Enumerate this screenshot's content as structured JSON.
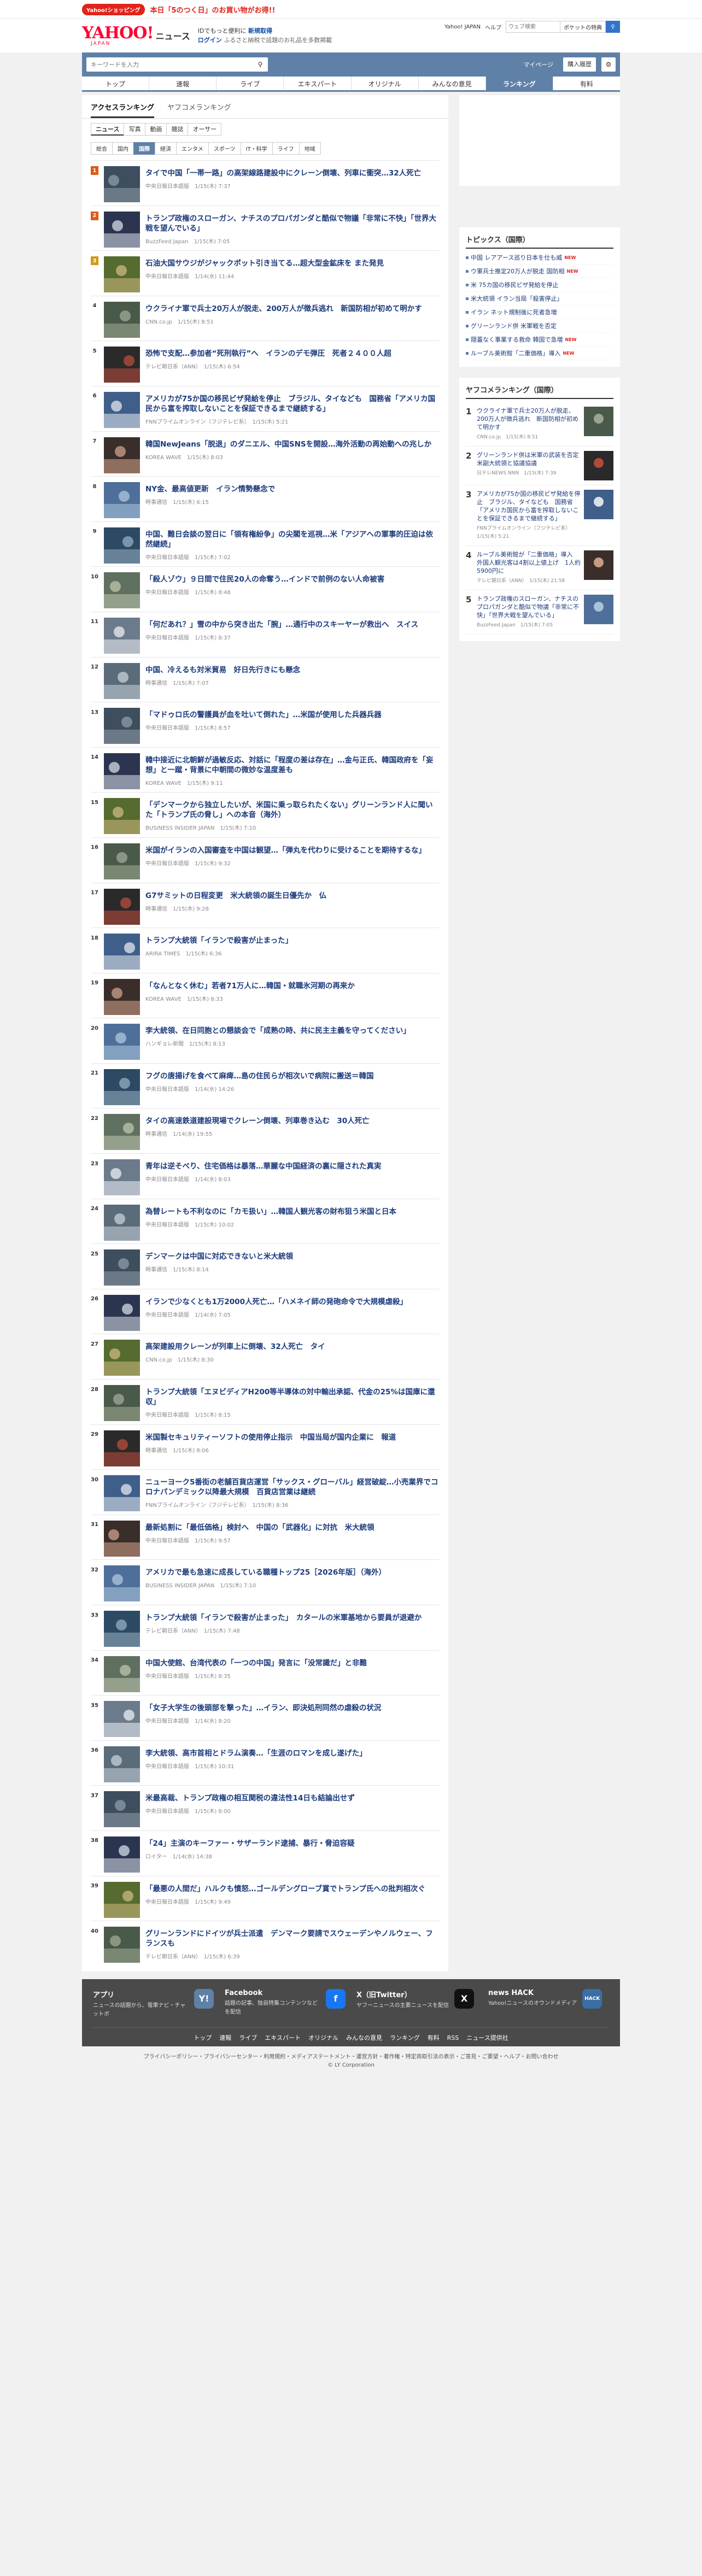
{
  "promo": {
    "pill": "Yahoo!ショッピング",
    "message": "本日「5のつく日」のお買い物がお得!!"
  },
  "header": {
    "logo": "YAHOO!",
    "logo_sub": "JAPAN",
    "section": "ニュース",
    "login_line1": "IDでもっと便利に",
    "login_line1_link": "新規取得",
    "login_line2_link": "ログイン",
    "login_line2_tail": "ふるさと納税で話題のお礼品を多数掲載",
    "links": [
      "Yahoo! JAPAN",
      "ヘルプ"
    ],
    "search_placeholder": "ウェブ検索",
    "search_button": "ポケットの特典"
  },
  "topbar": {
    "placeholder": "キーワードを入力",
    "mypage": "マイページ",
    "purchase": "購入履歴"
  },
  "nav": [
    "トップ",
    "速報",
    "ライブ",
    "エキスパート",
    "オリジナル",
    "みんなの意見",
    "ランキング",
    "有料"
  ],
  "nav_active": 6,
  "rank_tabs": [
    "アクセスランキング",
    "ヤフコメランキング"
  ],
  "content_tabs": [
    "ニュース",
    "写真",
    "動画",
    "雑誌",
    "オーサー"
  ],
  "genre_tabs": [
    "総合",
    "国内",
    "国際",
    "経済",
    "エンタメ",
    "スポーツ",
    "IT・科学",
    "ライフ",
    "地域"
  ],
  "genre_active": 2,
  "items": [
    {
      "rank": "1",
      "title": "タイで中国「一帯一路」の高架線路建設中にクレーン倒壊、列車に衝突…32人死亡",
      "meta": "中央日報日本語版　1/15(木) 7:37"
    },
    {
      "rank": "2",
      "title": "トランプ政権のスローガン、ナチスのプロパガンダと酷似で物議「非常に不快」「世界大戦を望んでいる」",
      "meta": "BuzzFeed Japan　1/15(木) 7:05"
    },
    {
      "rank": "3",
      "title": "石油大国サウジがジャックポット引き当てる…超大型金鉱床を また発見",
      "meta": "中央日報日本語版　1/14(水) 11:44"
    },
    {
      "rank": "4",
      "title": "ウクライナ軍で兵士20万人が脱走、200万人が徴兵逃れ　新国防相が初めて明かす",
      "meta": "CNN.co.jp　1/15(木) 8:51"
    },
    {
      "rank": "5",
      "title": "恐怖で支配…参加者“死刑執行”へ　イランのデモ弾圧　死者２４００人超",
      "meta": "テレビ朝日系（ANN）　1/15(木) 6:54"
    },
    {
      "rank": "6",
      "title": "アメリカが75か国の移民ビザ発給を停止　ブラジル、タイなども　国務省「アメリカ国民から富を搾取しないことを保証できるまで継続する」",
      "meta": "FNNプライムオンライン（フジテレビ系）　1/15(木) 5:21"
    },
    {
      "rank": "7",
      "title": "韓国NewJeans「脱退」のダニエル、中国SNSを開設…海外活動の再始動への兆しか",
      "meta": "KOREA WAVE　1/15(木) 8:03"
    },
    {
      "rank": "8",
      "title": "NY金、最高値更新　イラン情勢懸念で",
      "meta": "時事通信　1/15(木) 6:15"
    },
    {
      "rank": "9",
      "title": "中国、難日会談の翌日に「領有権紛争」の尖閣を巡視…米「アジアへの軍事的圧迫は依然継続」",
      "meta": "中央日報日本語版　1/15(木) 7:02"
    },
    {
      "rank": "10",
      "title": "「殺人ゾウ」９日間で住民20人の命奪う…インドで前例のない人命被害",
      "meta": "中央日報日本語版　1/15(木) 8:48"
    },
    {
      "rank": "11",
      "title": "「何だあれ？」雪の中から突き出た「腕」…通行中のスキーヤーが救出へ　スイス",
      "meta": "中央日報日本語版　1/15(木) 8:37"
    },
    {
      "rank": "12",
      "title": "中国、冷えるも対米貿易　好日先行きにも懸念",
      "meta": "時事通信　1/15(木) 7:07"
    },
    {
      "rank": "13",
      "title": "「マドゥロ氏の警護員が血を吐いて倒れた」…米国が使用した兵器兵器",
      "meta": "中央日報日本語版　1/15(木) 8:57"
    },
    {
      "rank": "14",
      "title": "韓中接近に北朝鮮が過敏反応、対話に「程度の差は存在」…金与正氏、韓国政府を「妄想」と一蹴・背景に中朝間の微妙な温度差も",
      "meta": "KOREA WAVE　1/15(木) 9:11"
    },
    {
      "rank": "15",
      "title": "「デンマークから独立したいが、米国に乗っ取られたくない」グリーンランド人に聞いた「トランプ氏の脅し」への本音（海外）",
      "meta": "BUSINESS INSIDER JAPAN　1/15(木) 7:10"
    },
    {
      "rank": "16",
      "title": "米国がイランの入国審査を中国は観望…「弾丸を代わりに受けることを期待するな」",
      "meta": "中央日報日本語版　1/15(木) 9:32"
    },
    {
      "rank": "17",
      "title": "G7サミットの日程変更　米大統領の誕生日優先か　仏",
      "meta": "時事通信　1/15(木) 9:28"
    },
    {
      "rank": "18",
      "title": "トランプ大統領「イランで殺害が止まった」",
      "meta": "ARIRA TIMES　1/15(木) 6:36"
    },
    {
      "rank": "19",
      "title": "「なんとなく休む」若者71万人に…韓国・就職氷河期の再来か",
      "meta": "KOREA WAVE　1/15(木) 8:33"
    },
    {
      "rank": "20",
      "title": "李大統領、在日同胞との懇談会で「成熟の時、共に民主主義を守ってください」",
      "meta": "ハンギョレ新聞　1/15(木) 8:13"
    },
    {
      "rank": "21",
      "title": "フグの唐揚げを食べて麻痺…島の住民らが相次いで病院に搬送＝韓国",
      "meta": "中央日報日本語版　1/14(水) 14:26"
    },
    {
      "rank": "22",
      "title": "タイの高速鉄道建設現場でクレーン倒壊、列車巻き込む　30人死亡",
      "meta": "時事通信　1/14(水) 19:55"
    },
    {
      "rank": "23",
      "title": "青年は逆そべり、住宅価格は暴落…華麗な中国経済の裏に隠された真実",
      "meta": "中央日報日本語版　1/14(水) 8:03"
    },
    {
      "rank": "24",
      "title": "為替レートも不利なのに「カモ扱い」…韓国人観光客の財布狙う米国と日本",
      "meta": "中央日報日本語版　1/15(木) 10:02"
    },
    {
      "rank": "25",
      "title": "デンマークは中国に対応できないと米大統領",
      "meta": "時事通信　1/15(木) 8:14"
    },
    {
      "rank": "26",
      "title": "イランで少なくとも1万2000人死亡…「ハメネイ師の発砲命令で大規模虐殺」",
      "meta": "中央日報日本語版　1/14(水) 7:05"
    },
    {
      "rank": "27",
      "title": "高架建設用クレーンが列車上に倒壊、32人死亡　タイ",
      "meta": "CNN.co.jp　1/15(木) 8:30"
    },
    {
      "rank": "28",
      "title": "トランプ大統領「エヌビディアH200等半導体の対中輸出承認、代金の25%は国庫に還収」",
      "meta": "中央日報日本語版　1/15(木) 8:15"
    },
    {
      "rank": "29",
      "title": "米国製セキュリティーソフトの使用停止指示　中国当局が国内企業に　報道",
      "meta": "時事通信　1/15(木) 8:06"
    },
    {
      "rank": "30",
      "title": "ニューヨーク5番街の老舗百貨店運営「サックス・グローバル」経営破綻…小売業界でコロナパンデミック以降最大規模　百貨店営業は継続",
      "meta": "FNNプライムオンライン（フジテレビ系）　1/15(木) 8:36"
    },
    {
      "rank": "31",
      "title": "最新処割に「最低価格」検討へ　中国の「武器化」に対抗　米大統領",
      "meta": "中央日報日本語版　1/15(木) 9:57"
    },
    {
      "rank": "32",
      "title": "アメリカで最も急速に成長している職種トップ25［2026年版］（海外）",
      "meta": "BUSINESS INSIDER JAPAN　1/15(木) 7:10"
    },
    {
      "rank": "33",
      "title": "トランプ大統領「イランで殺害が止まった」　カタールの米軍基地から要員が退避か",
      "meta": "テレビ朝日系（ANN）　1/15(木) 7:48"
    },
    {
      "rank": "34",
      "title": "中国大使館、台湾代表の「一つの中国」発言に「没常識だ」と非難",
      "meta": "中央日報日本語版　1/15(木) 8:35"
    },
    {
      "rank": "35",
      "title": "「女子大学生の後頭部を撃った」…イラン、即決処刑同然の虐殺の状況",
      "meta": "中央日報日本語版　1/14(水) 8:20"
    },
    {
      "rank": "36",
      "title": "李大統領、高市首相とドラム演奏…「生涯のロマンを成し遂げた」",
      "meta": "中央日報日本語版　1/15(木) 10:31"
    },
    {
      "rank": "37",
      "title": "米最高裁、トランプ政権の相互関税の違法性14日も結論出せず",
      "meta": "中央日報日本語版　1/15(木) 8:00"
    },
    {
      "rank": "38",
      "title": "「24」主演のキーファー・サザーランド逮捕、暴行・脅迫容疑",
      "meta": "ロイター　1/14(水) 14:38"
    },
    {
      "rank": "39",
      "title": "「最悪の人間だ」ハルクも憤怒…ゴールデングローブ賞でトランプ氏への批判相次ぐ",
      "meta": "中央日報日本語版　1/15(木) 9:49"
    },
    {
      "rank": "40",
      "title": "グリーンランドにドイツが兵士派遣　デンマーク要請でスウェーデンやノルウェー、フランスも",
      "meta": "テレビ朝日系（ANN）　1/15(木) 6:39"
    }
  ],
  "topics": {
    "title": "トピックス（国際）",
    "rows": [
      {
        "text": "中国 レアアース巡り日本を仕も威",
        "badge": "NEW"
      },
      {
        "text": "ウ軍兵士推定20万人が脱走 国防相",
        "badge": "NEW"
      },
      {
        "text": "米 75カ国の移民ビザ発給を停止",
        "badge": ""
      },
      {
        "text": "米大統領 イラン当局「殺害停止」",
        "badge": ""
      },
      {
        "text": "イラン ネット規制後に死者急増",
        "badge": ""
      },
      {
        "text": "グリーンランド併 米軍戦を否定",
        "badge": ""
      },
      {
        "text": "隠蓋なく事業する救命 韓国で急増",
        "badge": "NEW"
      },
      {
        "text": "ルーブル美術館「二重価格」導入",
        "badge": "NEW"
      }
    ]
  },
  "side_rank": {
    "title": "ヤフコメランキング（国際）",
    "items": [
      {
        "n": "1",
        "text": "ウクライナ軍で兵士20万人が脱走、200万人が徴兵逃れ　新国防相が初めて明かす",
        "meta": "CNN.co.jp　1/15(木) 8:51"
      },
      {
        "n": "2",
        "text": "グリーンランド併は米軍の武装を否定　米副大統領と協議協議",
        "meta": "日テレNEWS NNN　1/15(木) 7:39"
      },
      {
        "n": "3",
        "text": "アメリカが75か国の移民ビザ発給を停止　ブラジル、タイなども　国務省「アメリカ国民から富を搾取しないことを保証できるまで継続する」",
        "meta": "FNNプライムオンライン（フジテレビ系）　1/15(木) 5:21"
      },
      {
        "n": "4",
        "text": "ルーブル美術館が「二重価格」導入　外国人観光客は4割以上値上げ　1人約5900円に",
        "meta": "テレビ朝日系（ANN）　1/15(木) 21:58"
      },
      {
        "n": "5",
        "text": "トランプ政権のスローガン、ナチスのプロパガンダと酷似で物議「非常に不快」「世界大戦を望んでいる」",
        "meta": "BuzzFeed Japan　1/15(木) 7:05"
      }
    ]
  },
  "footer": {
    "cols": [
      {
        "title": "アプリ",
        "desc": "ニュースの話題から、電車ナビ・チャットボ",
        "icon": "Y!"
      },
      {
        "title": "Facebook",
        "desc": "話題の記事、独自特集コンテンツなどを配信",
        "icon": "f"
      },
      {
        "title": "X（旧Twitter）",
        "desc": "ヤフーニュースの主要ニュースを配信",
        "icon": "X"
      },
      {
        "title": "news HACK",
        "desc": "Yahoo!ニュースのオウンドメディア",
        "icon": "HACK"
      }
    ],
    "links": [
      "トップ",
      "速報",
      "ライブ",
      "エキスパート",
      "オリジナル",
      "みんなの意見",
      "ランキング",
      "有料",
      "RSS",
      "ニュース提供社"
    ],
    "bottom": "プライバシーポリシー・プライバシーセンター・利用規約・メディアステートメント・運営方針・著作権・特定商取引法の表示・ご意見・ご要望・ヘルプ・お問い合わせ",
    "copyright": "© LY Corporation"
  },
  "colors": {
    "accent": "#5f80a7",
    "rank_top": "#e05818",
    "rank_gold": "#d09a16",
    "link": "#1b3a7c"
  }
}
